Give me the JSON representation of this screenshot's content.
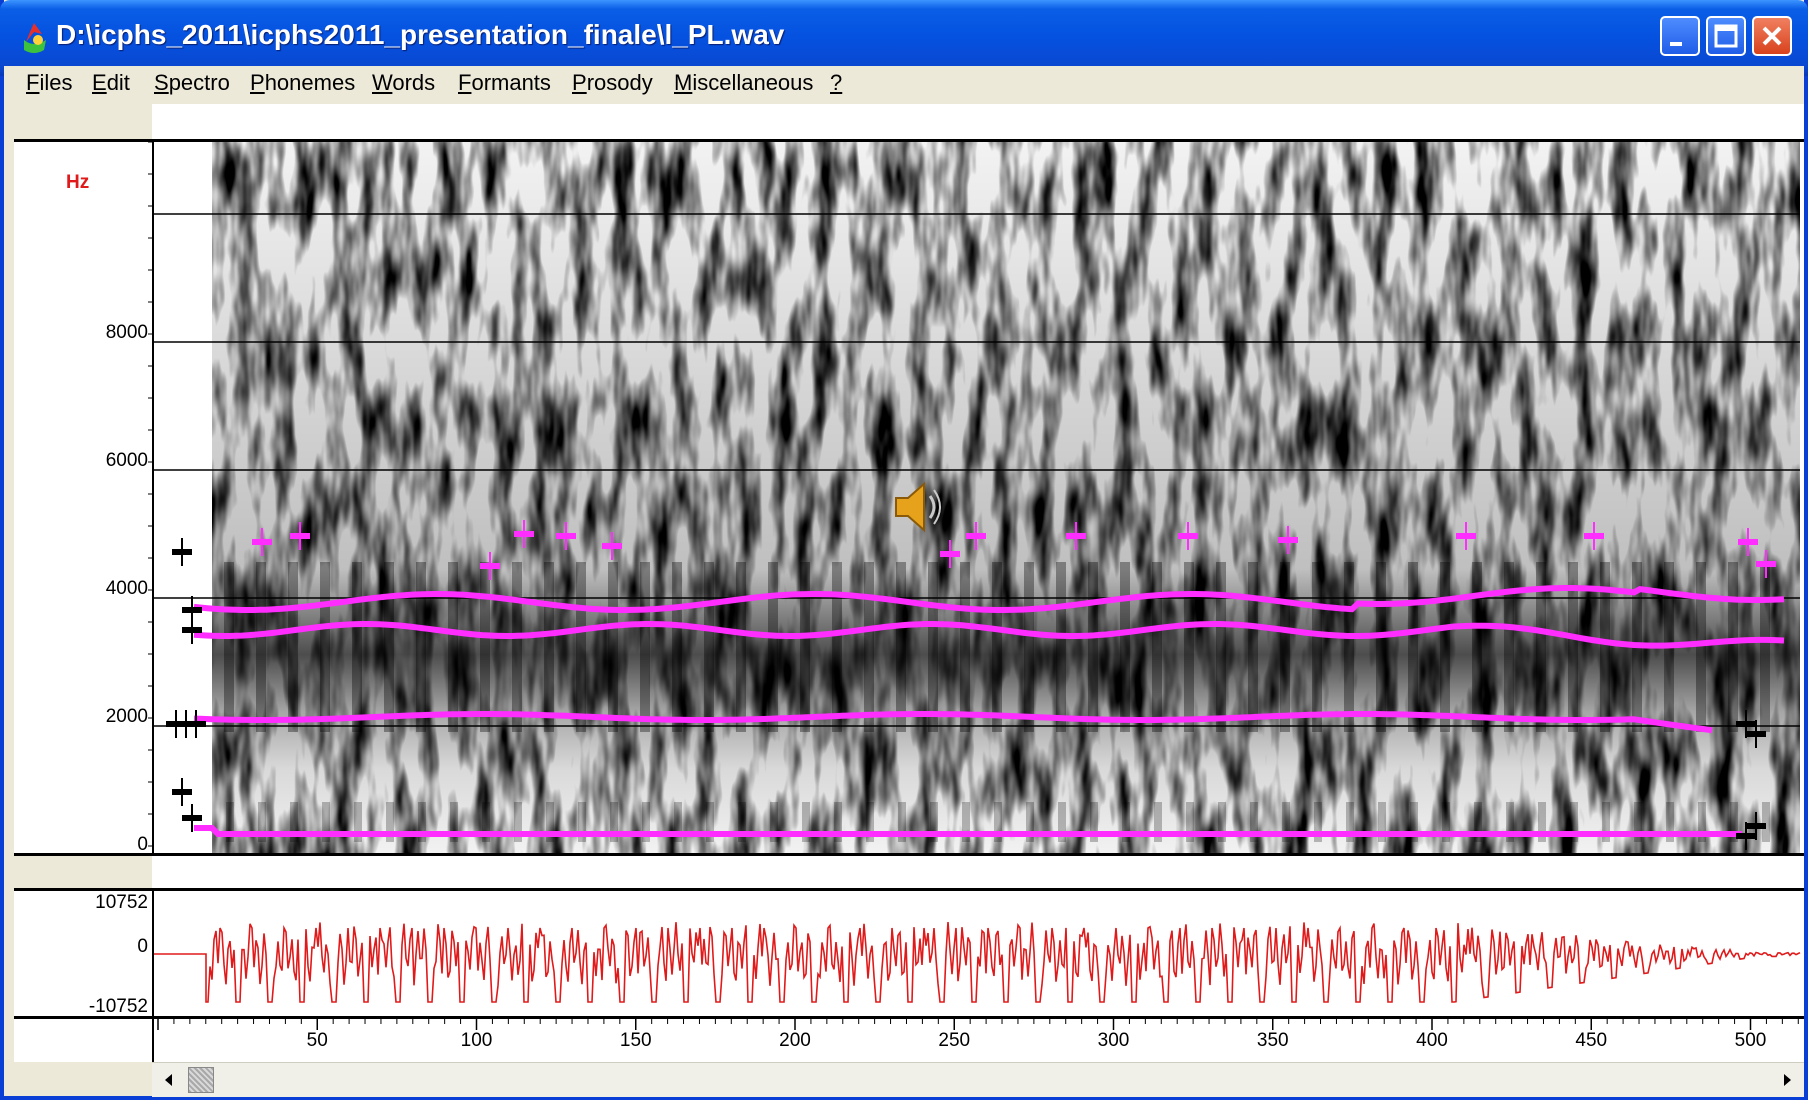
{
  "window": {
    "title": "D:\\icphs_2011\\icphs2011_presentation_finale\\l_PL.wav",
    "minimize_icon": "minimize-icon",
    "maximize_icon": "maximize-icon",
    "close_icon": "close-icon"
  },
  "menu": [
    {
      "label": "Files",
      "key": "F",
      "rest": "iles"
    },
    {
      "label": "Edit",
      "key": "E",
      "rest": "dit"
    },
    {
      "label": "Spectro",
      "key": "S",
      "rest": "pectro"
    },
    {
      "label": "Phonemes",
      "key": "P",
      "rest": "honemes"
    },
    {
      "label": "Words",
      "key": "W",
      "rest": "ords"
    },
    {
      "label": "Formants",
      "key": "F",
      "rest": "ormants"
    },
    {
      "label": "Prosody",
      "key": "P",
      "rest": "rosody"
    },
    {
      "label": "Miscellaneous",
      "key": "M",
      "rest": "iscellaneous"
    },
    {
      "label": "?",
      "key": "?",
      "rest": ""
    }
  ],
  "spectrogram": {
    "unit_label": "Hz",
    "y_ticks": [
      "8000",
      "6000",
      "4000",
      "2000",
      "0"
    ],
    "speaker_icon": "speaker-icon",
    "formant_color": "#ff2dff",
    "marker_color": "#000000"
  },
  "waveform": {
    "y_ticks": [
      "10752",
      "0",
      "-10752"
    ],
    "color": "#e01a1a"
  },
  "time_axis": {
    "ticks": [
      "50",
      "100",
      "150",
      "200",
      "250",
      "300",
      "350",
      "400",
      "450",
      "500"
    ]
  },
  "scrollbar": {
    "left_arrow_icon": "scroll-left-icon",
    "right_arrow_icon": "scroll-right-icon"
  }
}
